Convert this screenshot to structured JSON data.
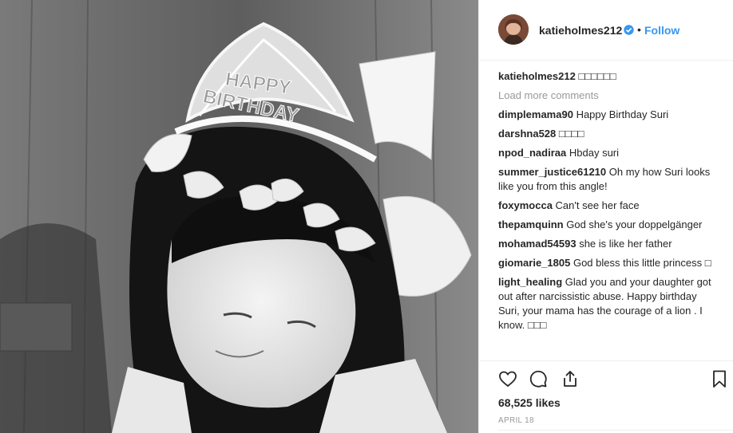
{
  "post": {
    "header": {
      "username": "katieholmes212",
      "separator": "•",
      "follow_label": "Follow"
    },
    "caption": {
      "author": "katieholmes212",
      "text": "□□□□□□"
    },
    "load_more_label": "Load more comments",
    "comments": [
      {
        "author": "dimplemama90",
        "text": "Happy Birthday Suri"
      },
      {
        "author": "darshna528",
        "text": "□□□□"
      },
      {
        "author": "npod_nadiraa",
        "text": "Hbday suri"
      },
      {
        "author": "summer_justice61210",
        "text": "Oh my how Suri looks like you from this angle!"
      },
      {
        "author": "foxymocca",
        "text": "Can't see her face"
      },
      {
        "author": "thepamquinn",
        "text": "God she's your doppelgänger"
      },
      {
        "author": "mohamad54593",
        "text": "she is like her father"
      },
      {
        "author": "giomarie_1805",
        "text": "God bless this little princess □"
      },
      {
        "author": "light_healing",
        "text": "Glad you and your daughter got out after narcissistic abuse. Happy birthday Suri, your mama has the courage of a lion . I know. □□□"
      }
    ],
    "likes": "68,525 likes",
    "date": "APRIL 18",
    "tiara_text": {
      "line1": "HAPPY",
      "line2": "BIRTHDAY"
    },
    "colors": {
      "follow": "#3897f0",
      "verified": "#3897f0",
      "muted": "#999999",
      "border": "#efefef"
    },
    "icons": {
      "like": "heart-icon",
      "comment": "comment-bubble-icon",
      "share": "share-icon",
      "save": "bookmark-icon",
      "verified": "verified-badge-icon"
    }
  }
}
